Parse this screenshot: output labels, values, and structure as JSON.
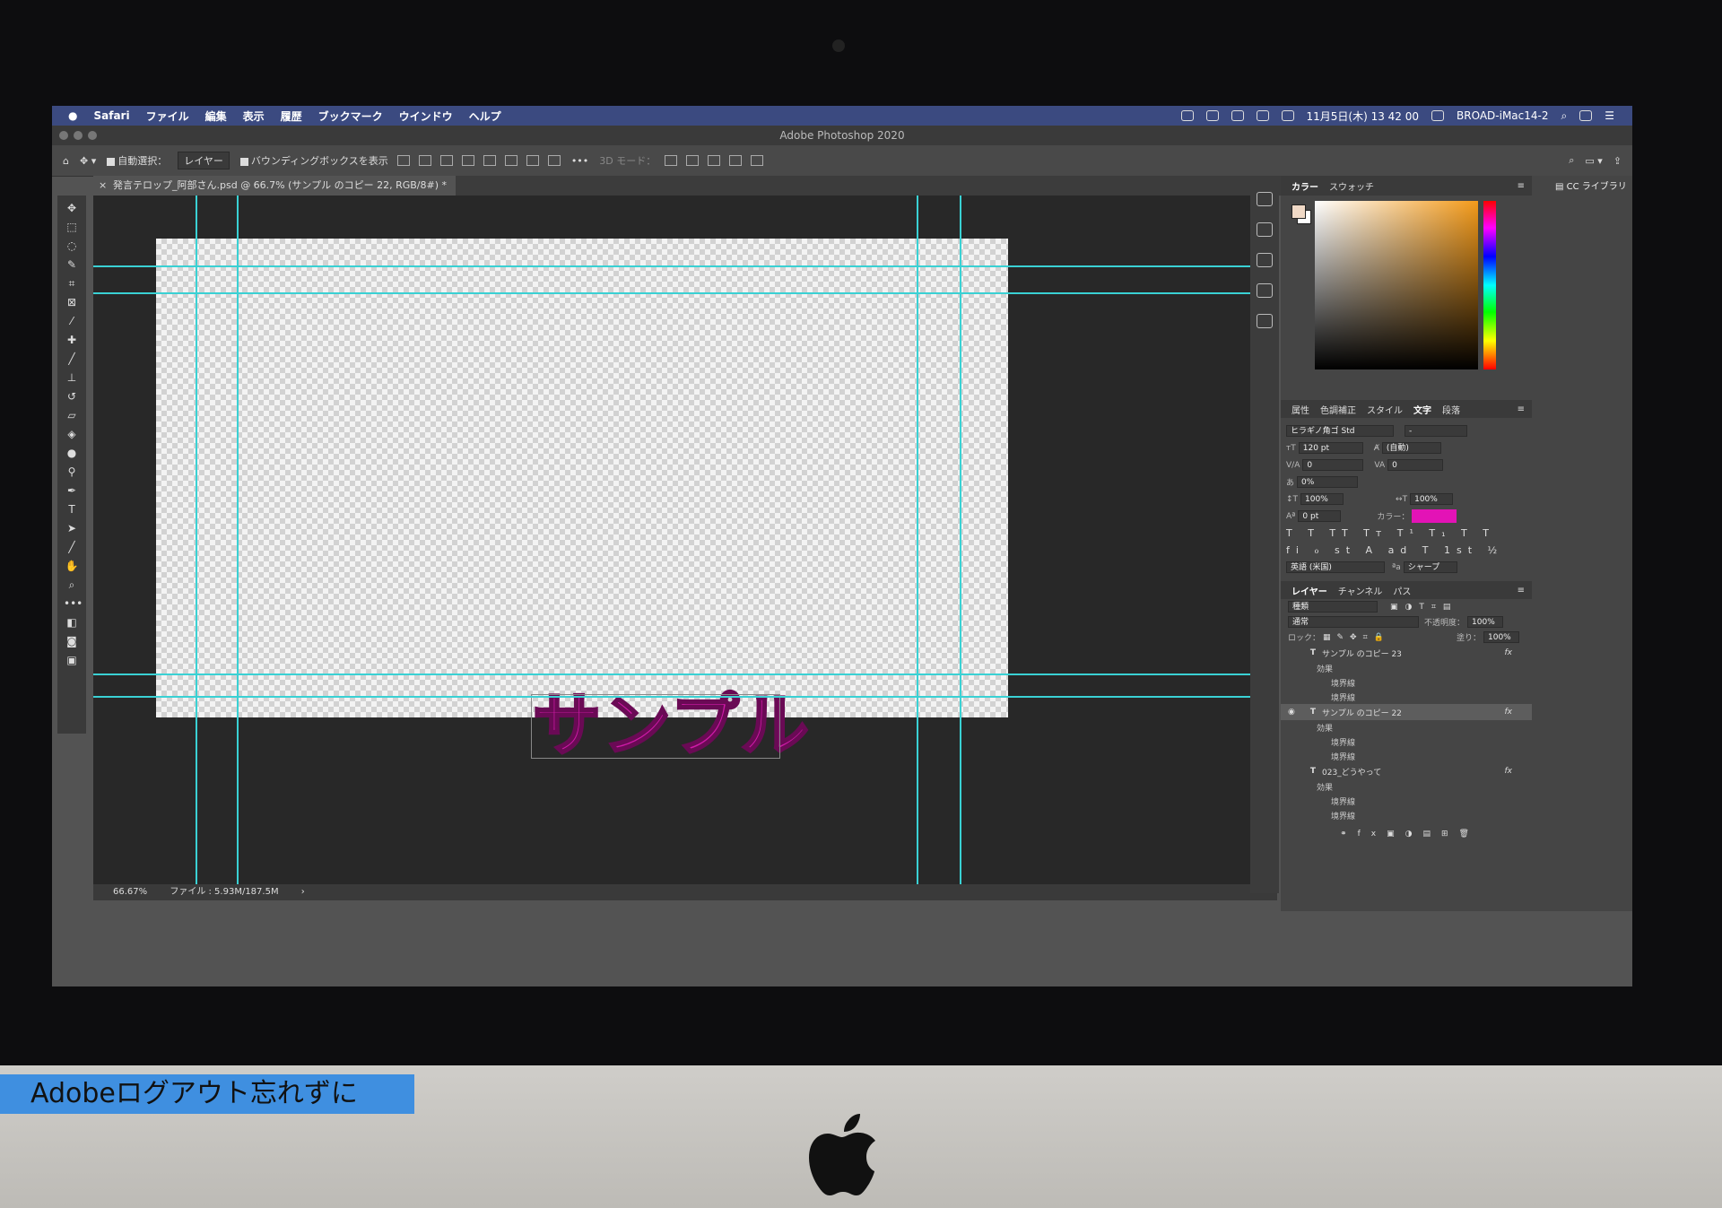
{
  "menubar": {
    "items": [
      "Safari",
      "ファイル",
      "編集",
      "表示",
      "履歴",
      "ブックマーク",
      "ウインドウ",
      "ヘルプ"
    ],
    "datetime": "11月5日(木) 13 42 00",
    "user": "BROAD-iMac14-2"
  },
  "app_title": "Adobe Photoshop 2020",
  "options": {
    "auto_select_label": "自動選択：",
    "auto_select_value": "レイヤー",
    "bounding_box_label": "バウンディングボックスを表示",
    "mode3d": "3D モード："
  },
  "document_tab": "発言テロップ_阿部さん.psd @ 66.7% (サンプル のコピー 22, RGB/8#) *",
  "canvas_text": "サンプル",
  "status": {
    "zoom": "66.67%",
    "file": "ファイル : 5.93M/187.5M"
  },
  "color_panel": {
    "tabs": [
      "カラー",
      "スウォッチ"
    ],
    "fg": "#f0d9c6",
    "bg": "#ffffff"
  },
  "char_panel": {
    "tabs": [
      "属性",
      "色調補正",
      "スタイル",
      "文字",
      "段落"
    ],
    "font": "ヒラギノ角ゴ Std",
    "style": "-",
    "size": "120 pt",
    "leading": "(自動)",
    "kerning": "0",
    "tracking": "0",
    "tsume": "0%",
    "vscale": "100%",
    "hscale": "100%",
    "baseline": "0 pt",
    "color_label": "カラー：",
    "color": "#e313b6",
    "glyph_row1": "T T TT Tт T¹ T₁ T T",
    "glyph_row2": "fi ℴ st A ad T 1st ½",
    "language": "英語 (米国)",
    "aa_icon": "ªa",
    "antialias": "シャープ"
  },
  "layers_panel": {
    "tabs": [
      "レイヤー",
      "チャンネル",
      "パス"
    ],
    "filter": "種類",
    "blend": "通常",
    "opacity_label": "不透明度：",
    "opacity": "100%",
    "lock_label": "ロック：",
    "fill_label": "塗り：",
    "fill": "100%",
    "layers": [
      {
        "name": "サンプル のコピー 23",
        "visible": false,
        "selected": false,
        "effects": [
          "効果",
          "境界線",
          "境界線"
        ]
      },
      {
        "name": "サンプル のコピー 22",
        "visible": true,
        "selected": true,
        "effects": [
          "効果",
          "境界線",
          "境界線"
        ]
      },
      {
        "name": "023_どうやって",
        "visible": false,
        "selected": false,
        "effects": [
          "効果",
          "境界線",
          "境界線"
        ]
      }
    ]
  },
  "cc_libraries": "CC ライブラリ",
  "caption": "Adobeログアウト忘れずに"
}
